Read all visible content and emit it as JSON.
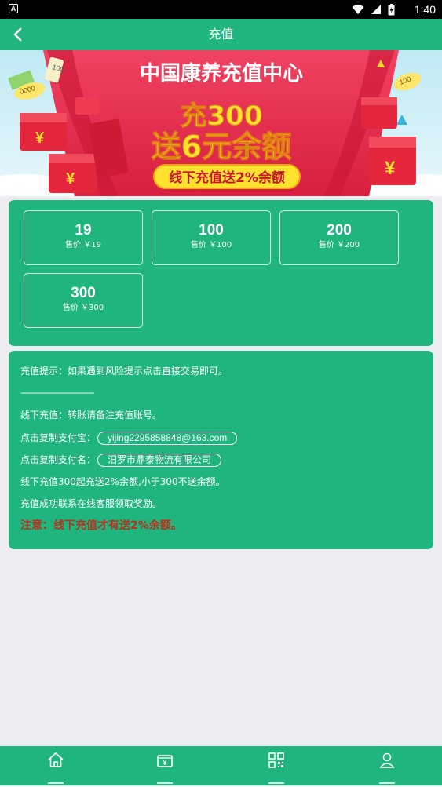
{
  "status_bar": {
    "notification_glyph": "A",
    "time": "1:40",
    "icons": [
      "wifi-icon",
      "signal-icon",
      "battery-charging-icon"
    ]
  },
  "header": {
    "title": "充值",
    "back_icon": "chevron-left-icon"
  },
  "banner": {
    "title": "中国康养充值中心",
    "line1": "充300",
    "line2": "送6元余额",
    "ribbon": "线下充值送2%余额",
    "decoration_texts": [
      "100",
      "0000",
      "100"
    ]
  },
  "amounts": [
    {
      "value": "19",
      "price": "售价 ￥19"
    },
    {
      "value": "100",
      "price": "售价 ￥100"
    },
    {
      "value": "200",
      "price": "售价 ￥200"
    },
    {
      "value": "300",
      "price": "售价 ￥300"
    }
  ],
  "info": {
    "tip": "充值提示：如果遇到风险提示点击直接交易即可。",
    "divider": "-----------------------------------",
    "offline": "线下充值：转账请备注充值账号。",
    "alipay_label": "点击复制支付宝：",
    "alipay_value": "yijing2295858848@163.com",
    "payee_label": "点击复制支付名：",
    "payee_value": "汨罗市鼎泰物流有限公司",
    "rule": "线下充值300起充送2%余额,小于300不送余额。",
    "contact": "充值成功联系在线客服领取奖励。",
    "warning": "注意：线下充值才有送2%余额。"
  },
  "bottom_nav": {
    "items": [
      "home-icon",
      "wallet-icon",
      "qr-code-icon",
      "user-icon"
    ]
  },
  "colors": {
    "primary": "#20b47f",
    "warning": "#b8321d",
    "background": "#ececf1",
    "banner_red": "#e52f4a",
    "banner_yellow": "#ffe22d"
  }
}
